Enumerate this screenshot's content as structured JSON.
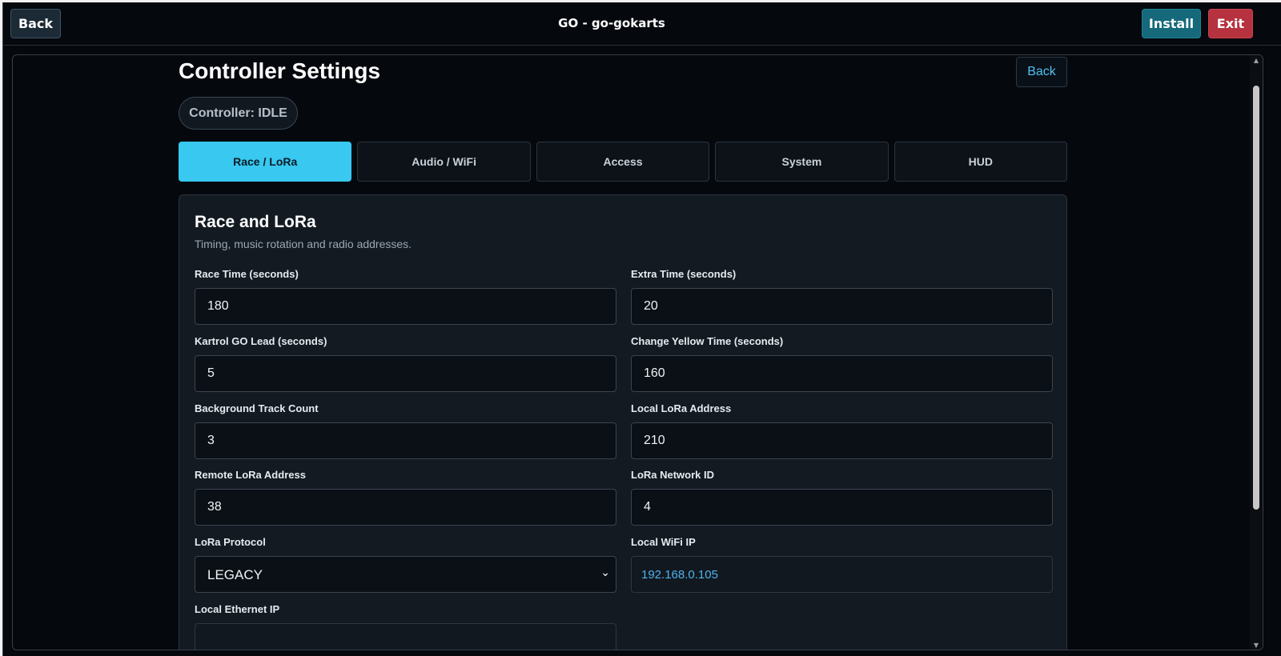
{
  "topbar": {
    "back_label": "Back",
    "title": "GO - go-gokarts",
    "install_label": "Install",
    "exit_label": "Exit"
  },
  "page": {
    "title": "Controller Settings",
    "back_label": "Back",
    "status": "Controller: IDLE"
  },
  "tabs": [
    {
      "label": "Race / LoRa",
      "active": true
    },
    {
      "label": "Audio / WiFi",
      "active": false
    },
    {
      "label": "Access",
      "active": false
    },
    {
      "label": "System",
      "active": false
    },
    {
      "label": "HUD",
      "active": false
    }
  ],
  "section": {
    "title": "Race and LoRa",
    "subtitle": "Timing, music rotation and radio addresses."
  },
  "fields": {
    "race_time": {
      "label": "Race Time (seconds)",
      "value": "180"
    },
    "extra_time": {
      "label": "Extra Time (seconds)",
      "value": "20"
    },
    "go_lead": {
      "label": "Kartrol GO Lead (seconds)",
      "value": "5"
    },
    "change_yellow": {
      "label": "Change Yellow Time (seconds)",
      "value": "160"
    },
    "track_count": {
      "label": "Background Track Count",
      "value": "3"
    },
    "local_lora": {
      "label": "Local LoRa Address",
      "value": "210"
    },
    "remote_lora": {
      "label": "Remote LoRa Address",
      "value": "38"
    },
    "network_id": {
      "label": "LoRa Network ID",
      "value": "4"
    },
    "protocol": {
      "label": "LoRa Protocol",
      "value": "LEGACY"
    },
    "wifi_ip": {
      "label": "Local WiFi IP",
      "value": "192.168.0.105"
    },
    "eth_ip": {
      "label": "Local Ethernet IP",
      "value": ""
    }
  },
  "colors": {
    "accent": "#38c8f0",
    "install": "#15697b",
    "exit": "#b6323e",
    "background": "#05080d",
    "link": "#4fc3f7"
  },
  "icons": {
    "select_arrow": "chevron-down-icon",
    "scroll_up": "arrow-up-icon",
    "scroll_down": "arrow-down-icon"
  }
}
